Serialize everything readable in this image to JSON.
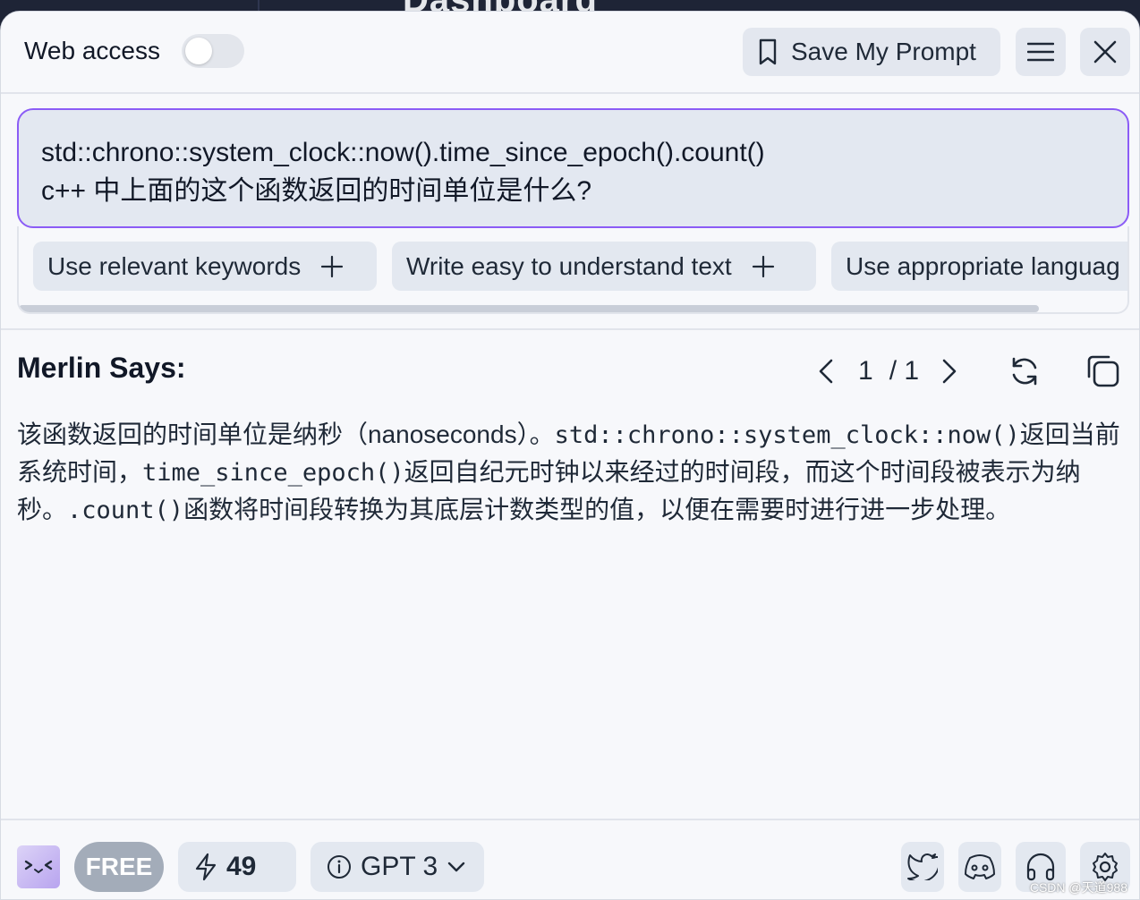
{
  "background": {
    "title": "Dashboard"
  },
  "header": {
    "web_access_label": "Web access",
    "web_access_enabled": false,
    "save_prompt_label": "Save My Prompt"
  },
  "prompt": {
    "line1": "std::chrono::system_clock::now().time_since_epoch().count()",
    "line2": "c++ 中上面的这个函数返回的时间单位是什么?"
  },
  "suggestions": [
    {
      "label": "Use relevant keywords"
    },
    {
      "label": "Write easy to understand text"
    },
    {
      "label": "Use appropriate languag"
    }
  ],
  "response": {
    "title": "Merlin Says:",
    "page_current": "1",
    "page_total": "/ 1",
    "segments": [
      "该函数返回的时间单位是纳秒（nanoseconds）。",
      "std::chrono::system_clock::now()",
      "返回当前系统时间，",
      "time_since_epoch()",
      "返回自纪元时钟以来经过的时间段，而这个时间段被表示为纳秒。",
      ".count()",
      "函数将时间段转换为其底层计数类型的值，以便在需要时进行进一步处理。"
    ]
  },
  "footer": {
    "plan_badge": "FREE",
    "credits": "49",
    "model": "GPT 3"
  },
  "watermark": "CSDN @天道988",
  "colors": {
    "accent": "#8b5cf6",
    "panel": "#f7f8fb",
    "chip": "#e3e8f0",
    "badge": "#a3acb9"
  }
}
